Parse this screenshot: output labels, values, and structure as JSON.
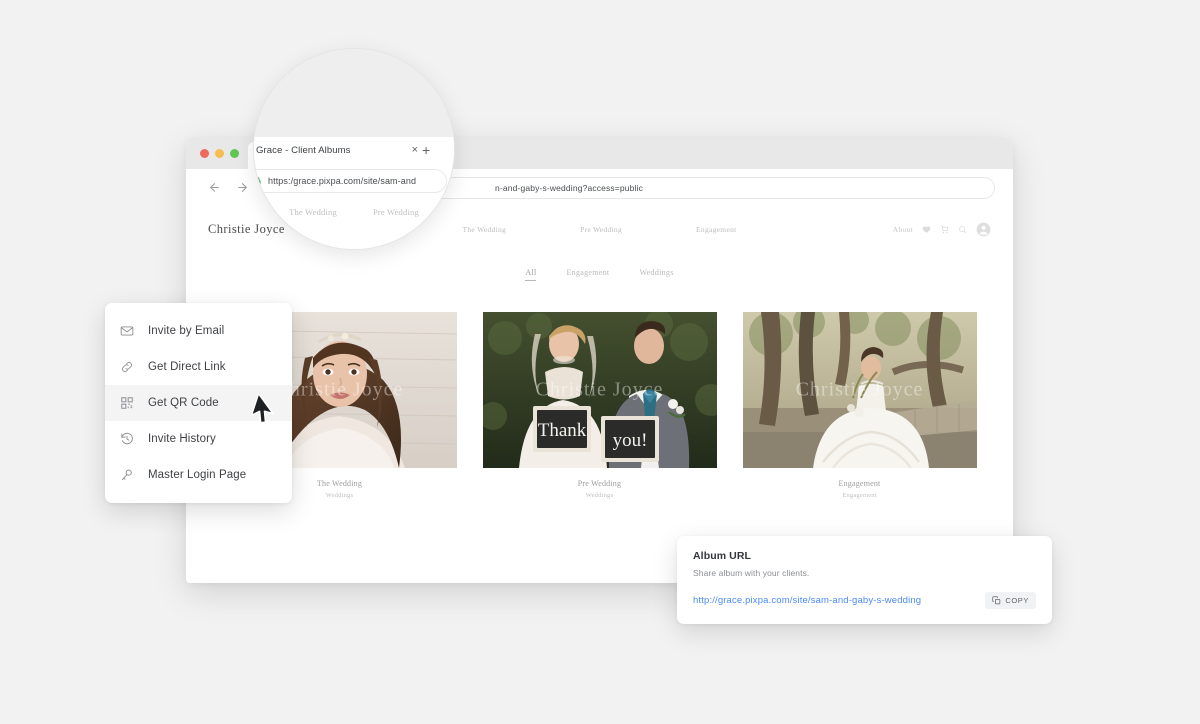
{
  "browser": {
    "traffic_lights": [
      {
        "name": "close",
        "color": "#ED6A5E"
      },
      {
        "name": "minimize",
        "color": "#F5BE4F"
      },
      {
        "name": "maximize",
        "color": "#61C554"
      }
    ],
    "tab_title": "Grace - Client Albums",
    "tab_close_glyph": "×",
    "new_tab_glyph": "+",
    "url_visible_tail": "n-and-gaby-s-wedding?access=public",
    "back_icon": "back-arrow-icon",
    "forward_icon": "forward-arrow-icon",
    "reload_icon": "reload-icon"
  },
  "magnifier": {
    "tab_title": "Grace - Client Albums",
    "tab_close_glyph": "×",
    "new_tab_glyph": "+",
    "url": "https:/grace.pixpa.com/site/sam-and",
    "nav_links": [
      "The Wedding",
      "Pre Wedding"
    ],
    "logo": "Christie"
  },
  "site": {
    "logo": "Christie Joyce",
    "nav_links": [
      "The Wedding",
      "Pre Wedding",
      "Engagement"
    ],
    "about_label": "About",
    "header_icons": [
      "heart-icon",
      "cart-icon",
      "search-icon",
      "account-icon"
    ],
    "filters": [
      {
        "label": "All",
        "active": true
      },
      {
        "label": "Engagement",
        "active": false
      },
      {
        "label": "Weddings",
        "active": false
      }
    ],
    "watermark": "Christie Joyce",
    "albums": [
      {
        "title": "The Wedding",
        "subtitle": "Weddings",
        "photo": "bride-portrait"
      },
      {
        "title": "Pre Wedding",
        "subtitle": "Weddings",
        "photo": "couple-thank-you-signs"
      },
      {
        "title": "Engagement",
        "subtitle": "Engagement",
        "photo": "bride-outdoors-trees"
      }
    ]
  },
  "context_menu": {
    "items": [
      {
        "label": "Invite by Email",
        "icon": "envelope-icon",
        "highlight": false
      },
      {
        "label": "Get Direct Link",
        "icon": "link-icon",
        "highlight": false
      },
      {
        "label": "Get QR Code",
        "icon": "qr-code-icon",
        "highlight": true
      },
      {
        "label": "Invite History",
        "icon": "history-clock-icon",
        "highlight": false
      },
      {
        "label": "Master Login Page",
        "icon": "key-icon",
        "highlight": false
      }
    ]
  },
  "album_url_popup": {
    "title": "Album URL",
    "subtitle": "Share album with your clients.",
    "url": "http://grace.pixpa.com/site/sam-and-gaby-s-wedding",
    "copy_label": "COPY",
    "copy_icon": "copy-icon",
    "link_color": "#4c8bf5"
  },
  "colors": {
    "page_background": "#f2f2f2",
    "window_background": "#ffffff",
    "titlebar": "#e8e8e9",
    "highlight": "#f4f4f5"
  }
}
